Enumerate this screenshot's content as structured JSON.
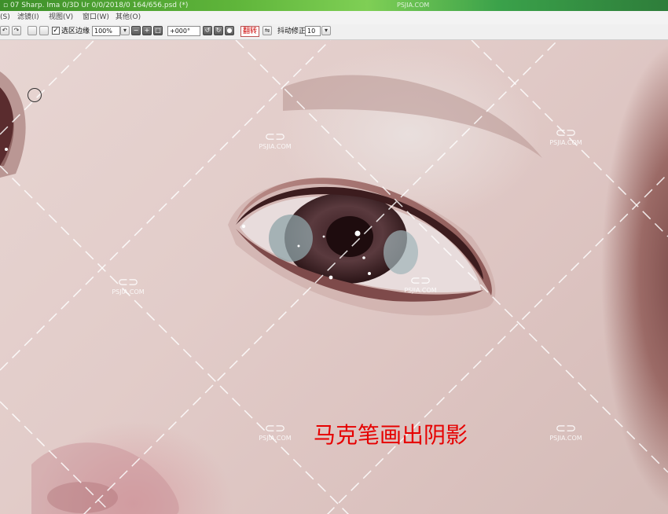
{
  "window": {
    "title": "▫ 07 Sharp. Ima 0/3D Ur 0/0/2018/0 164/656.psd (*)",
    "watermark_top": "PSJIA.COM"
  },
  "menu": {
    "items": [
      {
        "label": "选区(S)"
      },
      {
        "label": "滤镜(I)"
      },
      {
        "label": "视图(V)"
      },
      {
        "label": "窗口(W)"
      },
      {
        "label": "其他(O)"
      }
    ]
  },
  "toolbar": {
    "select_edge_label": "选区边缘",
    "select_edge_checked": "✓",
    "zoom_value": "100%",
    "rotation_value": "+000°",
    "flip_label": "翻转",
    "stabilizer_label": "抖动修正",
    "stabilizer_value": "10"
  },
  "canvas": {
    "caption": "马克笔画出阴影",
    "caption_color": "#e60000",
    "watermark_text": "PSJIA.COM"
  }
}
